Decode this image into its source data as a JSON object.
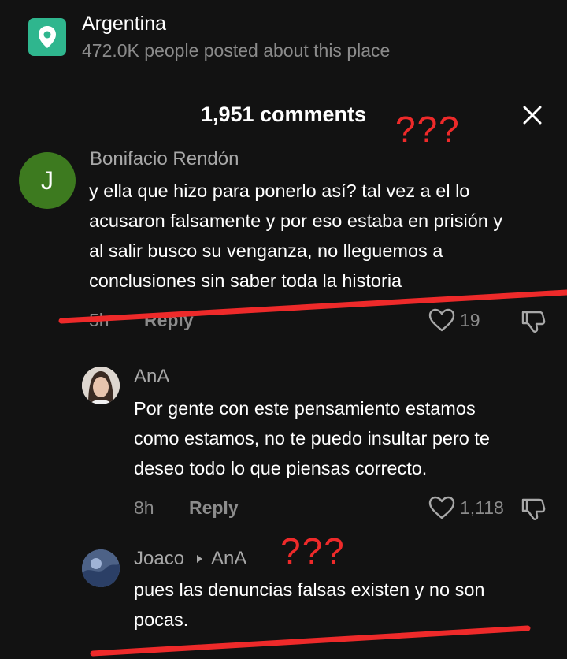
{
  "place": {
    "name": "Argentina",
    "subtitle": "472.0K people posted about this place",
    "icon": "location-pin-icon",
    "icon_bg": "#2fb68e"
  },
  "sheet": {
    "comment_count": "1,951 comments",
    "close_icon": "close-icon"
  },
  "annotations": {
    "mark_1": "???",
    "mark_2": "???",
    "color": "#ee2a2a"
  },
  "comments": [
    {
      "author": "Bonifacio Rendón",
      "avatar_letter": "J",
      "avatar_color": "#3d7a1f",
      "lines": [
        "y ella que hizo para ponerlo así? tal vez a el lo",
        "acusaron falsamente y por eso estaba en prisión y",
        "al salir busco su venganza, no lleguemos a",
        "conclusiones sin saber toda la historia"
      ],
      "time": "5h",
      "reply_label": "Reply",
      "likes": "19"
    },
    {
      "author": "AnA",
      "lines": [
        "Por gente con este pensamiento estamos",
        "como estamos, no te puedo insultar pero te",
        "deseo todo lo que piensas correcto."
      ],
      "time": "8h",
      "reply_label": "Reply",
      "likes": "1,118"
    },
    {
      "author": "Joaco",
      "reply_to": "AnA",
      "lines": [
        "pues las denuncias falsas existen y no son",
        "pocas."
      ]
    }
  ]
}
